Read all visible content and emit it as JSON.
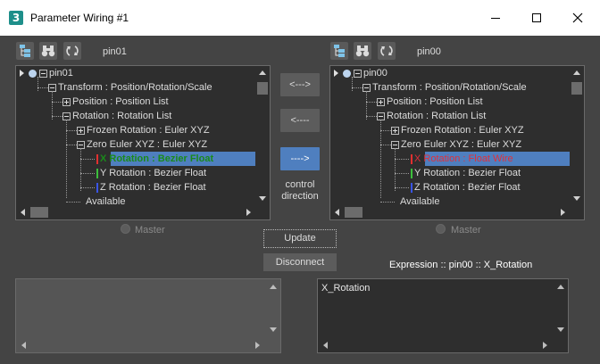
{
  "window": {
    "title": "Parameter Wiring #1",
    "icon_char": "3"
  },
  "left_panel": {
    "pin_label": "pin01",
    "tree": [
      {
        "text": "pin01",
        "level": 0,
        "expander": "minus",
        "root": true
      },
      {
        "text": "Transform : Position/Rotation/Scale",
        "level": 1,
        "expander": "minus"
      },
      {
        "text": "Position : Position List",
        "level": 2,
        "expander": "plus"
      },
      {
        "text": "Rotation : Rotation List",
        "level": 2,
        "expander": "minus"
      },
      {
        "text": "Frozen Rotation : Euler XYZ",
        "level": 3,
        "expander": "plus"
      },
      {
        "text": "Zero Euler XYZ : Euler XYZ",
        "level": 3,
        "expander": "minus"
      },
      {
        "text": "X Rotation : Bezier Float",
        "level": 4,
        "expander": "none",
        "selected": true,
        "color": "#1a8a1a",
        "bold": true,
        "marker": "#e23030"
      },
      {
        "text": "Y Rotation : Bezier Float",
        "level": 4,
        "expander": "none",
        "marker": "#3cbf3c"
      },
      {
        "text": "Z Rotation : Bezier Float",
        "level": 4,
        "expander": "none",
        "marker": "#3a55e6"
      },
      {
        "text": "Available",
        "level": 3,
        "expander": "none"
      }
    ],
    "master_label": "Master",
    "expression_text": ""
  },
  "right_panel": {
    "pin_label": "pin00",
    "tree": [
      {
        "text": "pin00",
        "level": 0,
        "expander": "minus",
        "root": true
      },
      {
        "text": "Transform : Position/Rotation/Scale",
        "level": 1,
        "expander": "minus"
      },
      {
        "text": "Position : Position List",
        "level": 2,
        "expander": "plus"
      },
      {
        "text": "Rotation : Rotation List",
        "level": 2,
        "expander": "minus"
      },
      {
        "text": "Frozen Rotation : Euler XYZ",
        "level": 3,
        "expander": "plus"
      },
      {
        "text": "Zero Euler XYZ : Euler XYZ",
        "level": 3,
        "expander": "minus"
      },
      {
        "text": "X Rotation : Float Wire",
        "level": 4,
        "expander": "none",
        "selected": true,
        "color": "#e0303a",
        "marker": "#e23030"
      },
      {
        "text": "Y Rotation : Bezier Float",
        "level": 4,
        "expander": "none",
        "marker": "#3cbf3c"
      },
      {
        "text": "Z Rotation : Bezier Float",
        "level": 4,
        "expander": "none",
        "marker": "#3a55e6"
      },
      {
        "text": "Available",
        "level": 3,
        "expander": "none"
      }
    ],
    "master_label": "Master",
    "expression_label": "Expression :: pin00 :: X_Rotation",
    "expression_text": "X_Rotation"
  },
  "direction": {
    "two_way_label": "<--->",
    "left_label": "<----",
    "right_label": "---->",
    "control_direction_label": "control\ndirection"
  },
  "actions": {
    "update_label": "Update",
    "disconnect_label": "Disconnect"
  },
  "colors": {
    "selection": "#4f7fbf",
    "background": "#444444",
    "tree_bg": "#2e2e2e"
  }
}
